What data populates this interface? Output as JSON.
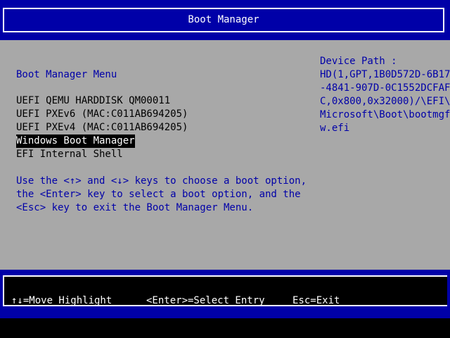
{
  "header": {
    "title": "Boot Manager"
  },
  "menu": {
    "title": "Boot Manager Menu",
    "items": [
      {
        "label": "UEFI QEMU HARDDISK QM00011"
      },
      {
        "label": "UEFI PXEv6 (MAC:C011AB694205)"
      },
      {
        "label": "UEFI PXEv4 (MAC:C011AB694205)"
      },
      {
        "label": "Windows Boot Manager",
        "selected": true
      },
      {
        "label": "EFI Internal Shell"
      }
    ]
  },
  "help": {
    "lines": [
      "Use the <↑> and <↓> keys to choose a boot option,",
      "the <Enter> key to select a boot option, and the",
      "<Esc> key to exit the Boot Manager Menu."
    ]
  },
  "device_path": {
    "label": "Device Path :",
    "lines": [
      "HD(1,GPT,1B0D572D-6B17",
      "-4841-907D-0C1552DCFAF",
      "C,0x800,0x32000)/\\EFI\\",
      "Microsoft\\Boot\\bootmgf",
      "w.efi"
    ]
  },
  "footer": {
    "move": "↑↓=Move Highlight",
    "select": "<Enter>=Select Entry",
    "exit": "Esc=Exit"
  },
  "colors": {
    "bios_blue": "#0000a8",
    "bios_gray": "#a8a8a8",
    "highlight_bg": "#000000",
    "highlight_fg": "#ffffff"
  }
}
